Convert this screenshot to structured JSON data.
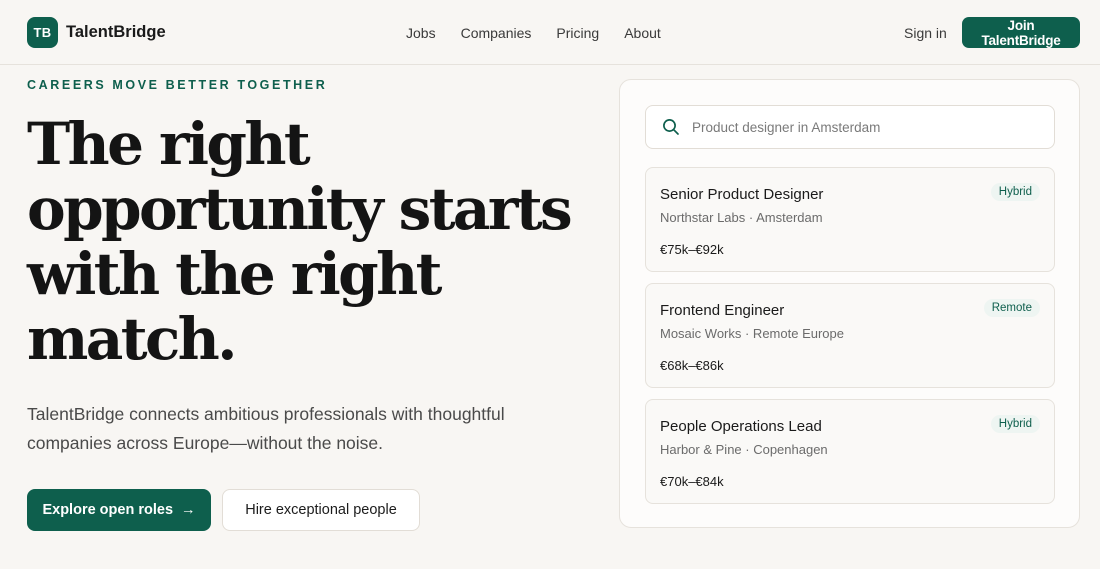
{
  "brand": {
    "mark": "TB",
    "name": "TalentBridge"
  },
  "nav": {
    "items": [
      "Jobs",
      "Companies",
      "Pricing",
      "About"
    ]
  },
  "header": {
    "signin_label": "Sign in",
    "join_label": "Join TalentBridge"
  },
  "hero": {
    "eyebrow": "CAREERS MOVE BETTER TOGETHER",
    "headline_lines": [
      "The right",
      "opportunity starts",
      "with the right",
      "match."
    ],
    "lede": "TalentBridge connects ambitious professionals with thoughtful companies across Europe—without the noise.",
    "primary_cta": "Explore open roles",
    "primary_cta_arrow": "→",
    "secondary_cta": "Hire exceptional people"
  },
  "search": {
    "placeholder": "Product designer in Amsterdam",
    "value": ""
  },
  "jobs": [
    {
      "title": "Senior Product Designer",
      "meta": "Northstar Labs · Amsterdam",
      "salary": "€75k–€92k",
      "badge": "Hybrid"
    },
    {
      "title": "Frontend Engineer",
      "meta": "Mosaic Works · Remote Europe",
      "salary": "€68k–€86k",
      "badge": "Remote"
    },
    {
      "title": "People Operations Lead",
      "meta": "Harbor & Pine · Copenhagen",
      "salary": "€70k–€84k",
      "badge": "Hybrid"
    }
  ],
  "colors": {
    "accent": "#0e5f4d",
    "background": "#f8f6f3",
    "badge_bg": "#eef5f2"
  },
  "icons": {
    "search": "search-icon",
    "arrow": "arrow-right-icon"
  }
}
